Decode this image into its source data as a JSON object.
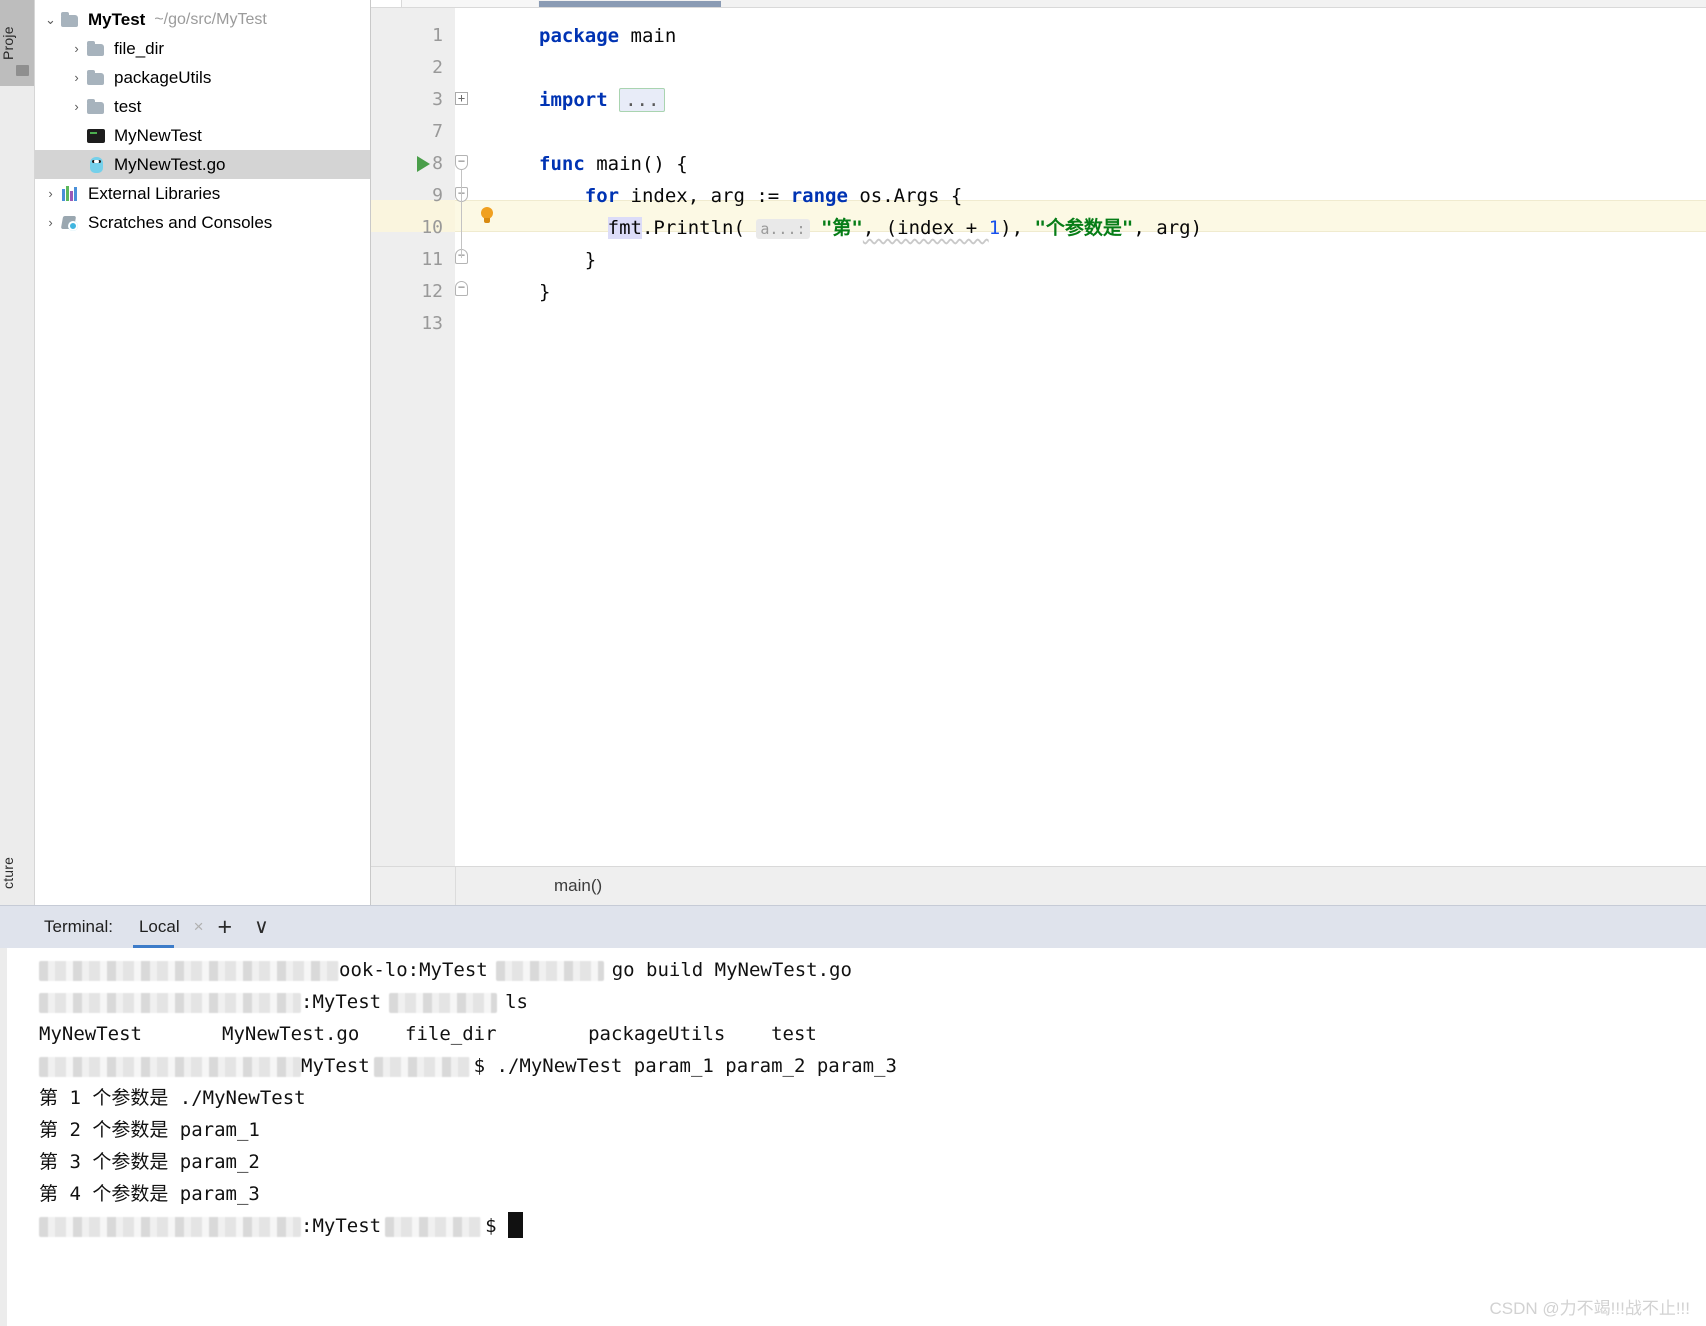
{
  "rail": {
    "project_label": "Proje",
    "structure_label": "cture"
  },
  "project_tree": {
    "items": [
      {
        "arrow": "⌄",
        "icon": "folder-icon",
        "name": "MyTest",
        "path": "~/go/src/MyTest",
        "bold": true,
        "indent": 0,
        "selected": false
      },
      {
        "arrow": "›",
        "icon": "folder-icon",
        "name": "file_dir",
        "path": "",
        "bold": false,
        "indent": 1,
        "selected": false
      },
      {
        "arrow": "›",
        "icon": "folder-icon",
        "name": "packageUtils",
        "path": "",
        "bold": false,
        "indent": 1,
        "selected": false
      },
      {
        "arrow": "›",
        "icon": "folder-icon",
        "name": "test",
        "path": "",
        "bold": false,
        "indent": 1,
        "selected": false
      },
      {
        "arrow": "",
        "icon": "executable-icon",
        "name": "MyNewTest",
        "path": "",
        "bold": false,
        "indent": 1,
        "selected": false
      },
      {
        "arrow": "",
        "icon": "go-file-icon",
        "name": "MyNewTest.go",
        "path": "",
        "bold": false,
        "indent": 1,
        "selected": true
      },
      {
        "arrow": "›",
        "icon": "libraries-icon",
        "name": "External Libraries",
        "path": "",
        "bold": false,
        "indent": 0,
        "selected": false
      },
      {
        "arrow": "›",
        "icon": "scratches-icon",
        "name": "Scratches and Consoles",
        "path": "",
        "bold": false,
        "indent": 0,
        "selected": false
      }
    ]
  },
  "editor": {
    "line_numbers": [
      "1",
      "2",
      "3",
      "7",
      "8",
      "9",
      "10",
      "11",
      "12",
      "13"
    ],
    "highlighted_line_number": "10",
    "code": {
      "l1_kw": "package",
      "l1_rest": " main",
      "l3_kw": "import",
      "l3_ellipsis": "...",
      "l8_kw": "func",
      "l8_rest": " main() {",
      "l9_kw_for": "for",
      "l9_mid": " index, arg := ",
      "l9_kw_range": "range",
      "l9_rest": " os.Args {",
      "l10_fmt": "fmt",
      "l10_dot_println": ".Println( ",
      "l10_hint": "a...:",
      "l10_s1": "\"第\"",
      "l10_mid": ", (index + ",
      "l10_num": "1",
      "l10_mid2": "), ",
      "l10_s2": "\"个参数是\"",
      "l10_tail": ", arg)",
      "l11": "}",
      "l12": "}"
    },
    "fold_plus": "+",
    "fold_minus": "−",
    "breadcrumb": "main()"
  },
  "terminal": {
    "label": "Terminal:",
    "tab_name": "Local",
    "close_icon": "×",
    "add_icon": "+",
    "chevron_icon": "∨",
    "lines": [
      {
        "type": "prompt",
        "pre_redact": 1,
        "host": "ook-l",
        "host2": "o:MyTest",
        "mid_redact": 1,
        "command": "go build MyNewTest.go"
      },
      {
        "type": "prompt",
        "pre_redact": 1,
        "host": "",
        "host2": ":MyTest",
        "mid_redact": 1,
        "command": "ls"
      },
      {
        "type": "output",
        "text": "MyNewTest       MyNewTest.go    file_dir        packageUtils    test"
      },
      {
        "type": "prompt",
        "pre_redact": 1,
        "host": "",
        "host2": "MyTest",
        "mid_redact": 1,
        "command": "./MyNewTest param_1 param_2 param_3"
      },
      {
        "type": "output",
        "text": "第 1 个参数是 ./MyNewTest"
      },
      {
        "type": "output",
        "text": "第 2 个参数是 param_1"
      },
      {
        "type": "output",
        "text": "第 3 个参数是 param_2"
      },
      {
        "type": "output",
        "text": "第 4 个参数是 param_3"
      },
      {
        "type": "cursor",
        "host2": ":MyTest",
        "prompt_char": "$"
      }
    ]
  },
  "watermark": {
    "text": "CSDN @力不竭!!!战不止!!!"
  },
  "colors": {
    "keyword": "#0033b3",
    "string": "#067d17",
    "number": "#1750eb",
    "highlight_line": "#fcf9e4",
    "tab_accent": "#3d7cc9",
    "run_green": "#4a9e4a",
    "bulb_orange": "#f0a020"
  }
}
